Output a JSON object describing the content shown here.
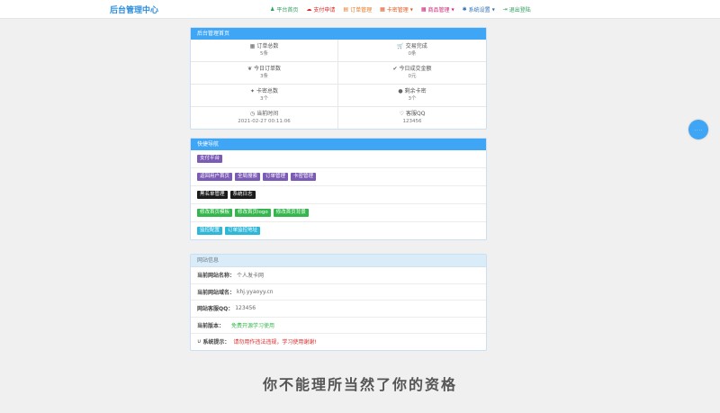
{
  "brand": "后台管理中心",
  "nav": [
    {
      "icon": "user-icon",
      "glyph": "♟",
      "label": "平台首页",
      "color": "#2e9e5b",
      "caret": false
    },
    {
      "icon": "cloud-icon",
      "glyph": "☁",
      "label": "支付申请",
      "color": "#e02424",
      "caret": false
    },
    {
      "icon": "orders-icon",
      "glyph": "▤",
      "label": "订单管理",
      "color": "#e07a24",
      "caret": false
    },
    {
      "icon": "cardkey-icon",
      "glyph": "▦",
      "label": "卡密管理",
      "color": "#e05a24",
      "caret": true
    },
    {
      "icon": "products-icon",
      "glyph": "▦",
      "label": "商品管理",
      "color": "#d0257b",
      "caret": true
    },
    {
      "icon": "gear-icon",
      "glyph": "✱",
      "label": "系统设置",
      "color": "#2f6fb5",
      "caret": true
    },
    {
      "icon": "logout-icon",
      "glyph": "⇥",
      "label": "退出登陆",
      "color": "#2e9e5b",
      "caret": false
    }
  ],
  "home_panel": {
    "title": "后台管理首页",
    "stats": [
      {
        "icon": "grid-icon",
        "glyph": "▦",
        "label": "订单总数",
        "value": "5条"
      },
      {
        "icon": "cart-icon",
        "glyph": "🛒",
        "label": "交易完成",
        "value": "0条"
      },
      {
        "icon": "leaf-icon",
        "glyph": "❦",
        "label": "今日订单数",
        "value": "3条"
      },
      {
        "icon": "check-icon",
        "glyph": "✔",
        "label": "今日成交金额",
        "value": "0元"
      },
      {
        "icon": "pin-icon",
        "glyph": "✦",
        "label": "卡密总数",
        "value": "3个"
      },
      {
        "icon": "dot-icon",
        "glyph": "●",
        "label": "剩余卡密",
        "value": "3个"
      },
      {
        "icon": "clock-icon",
        "glyph": "◷",
        "label": "当前时间",
        "value": "2021-02-27 00:11:06"
      },
      {
        "icon": "heart-icon",
        "glyph": "♡",
        "label": "客服QQ",
        "value": "123456"
      }
    ]
  },
  "quick_nav": {
    "title": "快捷导航",
    "rows": [
      [
        {
          "label": "支付平台",
          "color": "purple"
        }
      ],
      [
        {
          "label": "返回用户首页",
          "color": "purple"
        },
        {
          "label": "全局搜索",
          "color": "purple"
        },
        {
          "label": "订单管理",
          "color": "purple"
        },
        {
          "label": "卡密管理",
          "color": "purple"
        }
      ],
      [
        {
          "label": "黑名单管理",
          "color": "black"
        },
        {
          "label": "系统日志",
          "color": "black"
        }
      ],
      [
        {
          "label": "修改首页模板",
          "color": "green"
        },
        {
          "label": "修改首页logo",
          "color": "green"
        },
        {
          "label": "修改首页背景",
          "color": "green"
        }
      ],
      [
        {
          "label": "监控配置",
          "color": "teal"
        },
        {
          "label": "订单监控地址",
          "color": "teal"
        }
      ]
    ]
  },
  "site_info": {
    "title": "网站信息",
    "rows": [
      {
        "label": "当前网站名称：",
        "value": "个人发卡网",
        "style": ""
      },
      {
        "label": "当前网站域名：",
        "value": "khj.yyaoyy.cn",
        "style": ""
      },
      {
        "label": "网站客服QQ：",
        "value": "123456",
        "style": ""
      },
      {
        "label": "当前版本：",
        "value": "免费开源学习使用",
        "style": "green"
      },
      {
        "label": "系统提示：",
        "value": "请勿用作违法违规，学习使用谢谢!",
        "style": "red",
        "icon": "magnet-icon",
        "glyph": "∪"
      }
    ]
  },
  "slogan": "你不能理所当然了你的资格"
}
